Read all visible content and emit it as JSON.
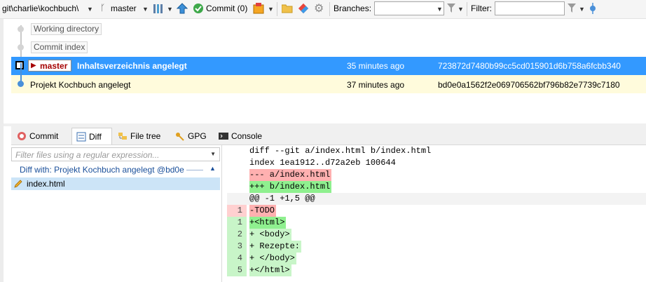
{
  "toolbar": {
    "path": "git\\charlie\\kochbuch\\",
    "branch": "master",
    "commit_label": "Commit (0)",
    "branches_label": "Branches:",
    "branches_value": "",
    "filter_label": "Filter:",
    "filter_value": ""
  },
  "grid": {
    "working_directory": "Working directory",
    "commit_index": "Commit index",
    "commits": [
      {
        "branch": "master",
        "message": "Inhaltsverzeichnis angelegt",
        "date": "35 minutes ago",
        "hash": "723872d7480b99cc5cd015901d6b758a6fcbb340"
      },
      {
        "message": "Projekt Kochbuch angelegt",
        "date": "37 minutes ago",
        "hash": "bd0e0a1562f2e069706562bf796b82e7739c7180"
      }
    ]
  },
  "tabs": [
    "Commit",
    "Diff",
    "File tree",
    "GPG",
    "Console"
  ],
  "files": {
    "filter_placeholder": "Filter files using a regular expression...",
    "diff_with": "Diff with: Projekt Kochbuch angelegt @bd0e",
    "items": [
      "index.html"
    ]
  },
  "diff": {
    "header": [
      "diff --git a/index.html b/index.html",
      "index 1ea1912..d72a2eb 100644"
    ],
    "old_file": "--- a/index.html",
    "new_file": "+++ b/index.html",
    "hunk": "@@ -1 +1,5 @@",
    "lines": [
      {
        "old": "1",
        "new": "",
        "text": "-TODO",
        "type": "del"
      },
      {
        "old": "",
        "new": "1",
        "text": "+<html>",
        "type": "add"
      },
      {
        "old": "",
        "new": "2",
        "text": "+ <body>",
        "type": "add"
      },
      {
        "old": "",
        "new": "3",
        "text": "+ Rezepte:",
        "type": "add"
      },
      {
        "old": "",
        "new": "4",
        "text": "+ </body>",
        "type": "add"
      },
      {
        "old": "",
        "new": "5",
        "text": "+</html>",
        "type": "add"
      }
    ]
  },
  "colors": {
    "selection": "#3399ff",
    "highlight_row": "#fffbdc",
    "add_bg": "#8ff08f",
    "del_bg": "#ffb0b0",
    "branch_red": "#a50000"
  },
  "icons": [
    "folder-icon",
    "sitemap-icon",
    "arrow-up-icon",
    "commit-check-icon",
    "stash-icon",
    "open-folder-icon",
    "git-diamond-icon",
    "settings-gear-icon",
    "filter-funnel-icon",
    "branch-icon",
    "pull-icon"
  ]
}
